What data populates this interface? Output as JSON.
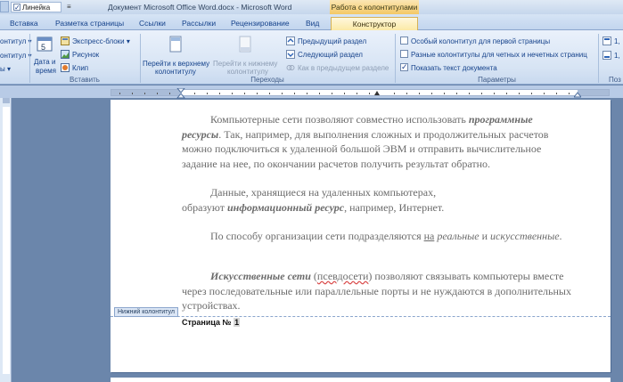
{
  "titlebar": {
    "qat_checkbox_label": "Линейка",
    "title": "Документ Microsoft Office Word.docx - Microsoft Word",
    "context_group": "Работа с колонтитулами"
  },
  "tabs": [
    {
      "label": "Вставка"
    },
    {
      "label": "Разметка страницы"
    },
    {
      "label": "Ссылки"
    },
    {
      "label": "Рассылки"
    },
    {
      "label": "Рецензирование"
    },
    {
      "label": "Вид"
    },
    {
      "label": "Конструктор"
    }
  ],
  "ribbon": {
    "headerfooter": {
      "items": [
        "онтитул ▾",
        "онтитул ▾",
        "ы ▾"
      ]
    },
    "insert": {
      "date_time_1": "Дата и",
      "date_time_2": "время",
      "quick_parts": "Экспресс-блоки ▾",
      "picture": "Рисунок",
      "clip": "Клип",
      "label": "Вставить"
    },
    "navigation": {
      "goto_header_1": "Перейти к верхнему",
      "goto_header_2": "колонтитулу",
      "goto_footer_1": "Перейти к нижнему",
      "goto_footer_2": "колонтитулу",
      "prev_section": "Предыдущий раздел",
      "next_section": "Следующий раздел",
      "link_prev": "Как в предыдущем разделе",
      "label": "Переходы"
    },
    "options": {
      "first_page": "Особый колонтитул для первой страницы",
      "odd_even": "Разные колонтитулы для четных и нечетных страниц",
      "show_text": "Показать текст документа",
      "label": "Параметры"
    },
    "position": {
      "v1": "1,",
      "v2": "1,",
      "label": "Поз"
    }
  },
  "document": {
    "p1_a": "Компьютерные сети позволяют совместно использовать ",
    "p1_b": "программные ресурсы",
    "p1_c": ". Так, например, для выполнения сложных и продолжительных расчетов можно подключиться к удаленной большой ЭВМ и отправить вычислительное задание на нее, по окончании расчетов получить результат обратно.",
    "p2_a": "Данные, хранящиеся на удаленных компьютерах,",
    "p2_b": "образуют ",
    "p2_c": "информационный ресурс",
    "p2_d": ", например, Интернет.",
    "p3_a": "По способу организации сети подразделяются ",
    "p3_b": "на",
    "p3_c": " ",
    "p3_d": "реальные",
    "p3_e": " и ",
    "p3_f": "искусственные",
    "p3_g": ".",
    "p4_a": "Искусственные сети",
    "p4_b": " (",
    "p4_c": "псевдосети",
    "p4_d": ") позволяют связывать компьютеры вместе через последовательные или параллельные порты и не нуждаются в дополнительных устройствах.",
    "footer_tag": "Нижний колонтитул",
    "page_label": "Страница № ",
    "page_field": "1"
  }
}
